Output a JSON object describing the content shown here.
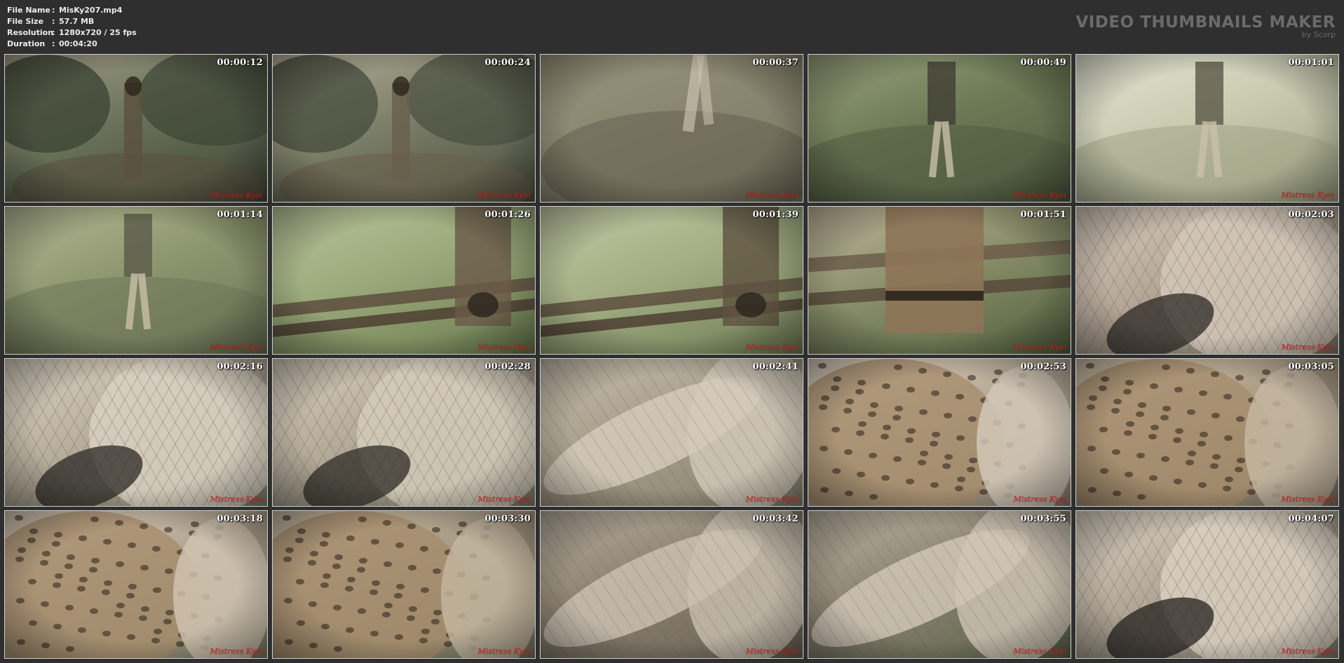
{
  "header": {
    "file_info": [
      {
        "key": "File Name",
        "sep": ":",
        "value": "MisKy207.mp4"
      },
      {
        "key": "File Size",
        "sep": ":",
        "value": "57.7 MB"
      },
      {
        "key": "Resolution",
        "sep": ":",
        "value": "1280x720 / 25 fps"
      },
      {
        "key": "Duration",
        "sep": ":",
        "value": "00:04:20"
      }
    ],
    "brand_title": "VIDEO THUMBNAILS MAKER",
    "brand_sub": "by Scorp"
  },
  "watermark_text": "Mistress Kym",
  "colors": {
    "background": "#2f2f2f",
    "thumb_border": "#cfcfcf",
    "timestamp": "#ffffff",
    "watermark": "#d02020"
  },
  "thumbnails": [
    {
      "time": "00:00:12",
      "scene": "forest-path",
      "palette": [
        "#3d4635",
        "#6a725a",
        "#a39e88",
        "#5a523f"
      ]
    },
    {
      "time": "00:00:24",
      "scene": "forest-path",
      "palette": [
        "#4a4f3f",
        "#7d8069",
        "#b3ae99",
        "#6a604c"
      ]
    },
    {
      "time": "00:00:37",
      "scene": "blurred-path",
      "palette": [
        "#6b6957",
        "#8a8670",
        "#a6a087",
        "#5b5645"
      ]
    },
    {
      "time": "00:00:49",
      "scene": "grass-walk",
      "palette": [
        "#4f5a40",
        "#6e7a56",
        "#97a07c",
        "#403f33"
      ]
    },
    {
      "time": "00:01:01",
      "scene": "grass-walk",
      "palette": [
        "#9ea184",
        "#c8cbb0",
        "#e3e4d2",
        "#5b5647"
      ]
    },
    {
      "time": "00:01:14",
      "scene": "grass-walk",
      "palette": [
        "#6b7355",
        "#8e966f",
        "#b3b793",
        "#5a5a48"
      ]
    },
    {
      "time": "00:01:26",
      "scene": "bench",
      "palette": [
        "#6a7b4f",
        "#9aa97a",
        "#b9c39a",
        "#6a5a48"
      ]
    },
    {
      "time": "00:01:39",
      "scene": "bench",
      "palette": [
        "#6f7d55",
        "#a3ae83",
        "#c2c8a4",
        "#5e5140"
      ]
    },
    {
      "time": "00:01:51",
      "scene": "bench-sit",
      "palette": [
        "#53613f",
        "#8a8f6a",
        "#c0b59c",
        "#5d4a37"
      ]
    },
    {
      "time": "00:02:03",
      "scene": "closeup",
      "palette": [
        "#5a5745",
        "#a8998a",
        "#d2c7b8",
        "#2e2a25"
      ]
    },
    {
      "time": "00:02:16",
      "scene": "closeup",
      "palette": [
        "#5d6048",
        "#a89d8b",
        "#d8d0c1",
        "#2c2a26"
      ]
    },
    {
      "time": "00:02:28",
      "scene": "closeup",
      "palette": [
        "#5a5c47",
        "#a49a89",
        "#d4cbbb",
        "#2f2c27"
      ]
    },
    {
      "time": "00:02:41",
      "scene": "legs",
      "palette": [
        "#7e7a64",
        "#a79e8a",
        "#d3cabb",
        "#4a4438"
      ]
    },
    {
      "time": "00:02:53",
      "scene": "leopard",
      "palette": [
        "#6a5f4d",
        "#a69680",
        "#d5cabb",
        "#2e2820"
      ]
    },
    {
      "time": "00:03:05",
      "scene": "leopard",
      "palette": [
        "#5e5343",
        "#9c8b74",
        "#c7b9a4",
        "#2a241d"
      ]
    },
    {
      "time": "00:03:18",
      "scene": "leopard",
      "palette": [
        "#565a43",
        "#a29480",
        "#d2c5b3",
        "#2b261f"
      ]
    },
    {
      "time": "00:03:30",
      "scene": "leopard",
      "palette": [
        "#4e5740",
        "#978a74",
        "#c4b6a0",
        "#282219"
      ]
    },
    {
      "time": "00:03:42",
      "scene": "legs",
      "palette": [
        "#5e5849",
        "#8b8170",
        "#c9c0b0",
        "#3a342b"
      ]
    },
    {
      "time": "00:03:55",
      "scene": "legs",
      "palette": [
        "#4f5a3f",
        "#8b8372",
        "#cfc6b6",
        "#3b3429"
      ]
    },
    {
      "time": "00:04:07",
      "scene": "closeup",
      "palette": [
        "#5a5648",
        "#a19684",
        "#d8cfc0",
        "#252220"
      ]
    }
  ]
}
